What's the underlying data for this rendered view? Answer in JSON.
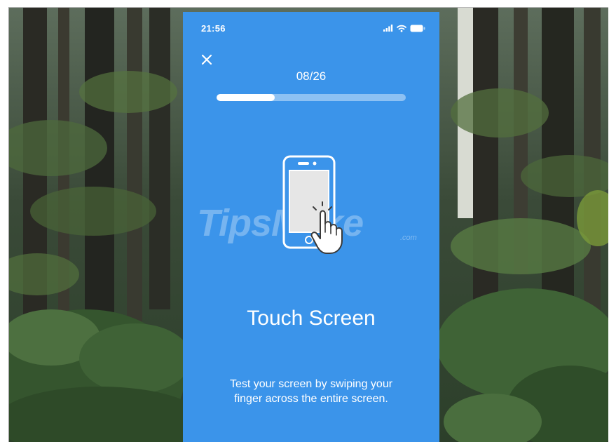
{
  "status_bar": {
    "time": "21:56",
    "icons": [
      "signal-icon",
      "wifi-icon",
      "battery-icon"
    ]
  },
  "header": {
    "close_icon": "close-icon",
    "progress_text": "08/26",
    "progress_fraction": 0.3077
  },
  "illustration": {
    "icon": "phone-touch-icon"
  },
  "watermark": {
    "text": "TipsMake",
    "suffix": ".com"
  },
  "content": {
    "title": "Touch Screen",
    "description": "Test your screen by swiping your finger across the entire screen."
  },
  "colors": {
    "accent": "#3b94ea",
    "text": "#ffffff"
  }
}
